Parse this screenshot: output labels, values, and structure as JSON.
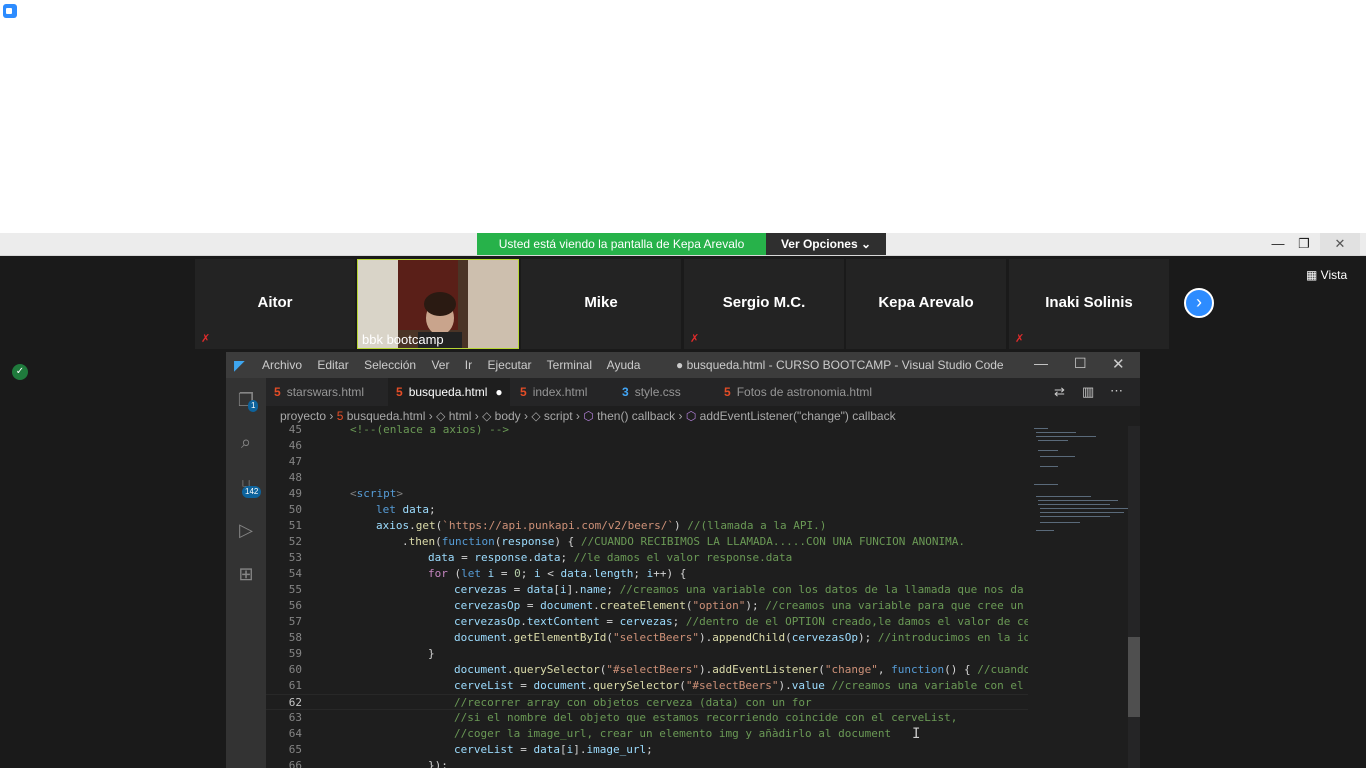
{
  "zoom": {
    "banner_text": "Usted está viendo la pantalla de Kepa Arevalo",
    "view_options": "Ver Opciones",
    "view_label": "Vista",
    "participants": [
      {
        "name": "Aitor",
        "muted": true
      },
      {
        "name": "bbk bootcamp",
        "muted": false,
        "video": true
      },
      {
        "name": "Mike",
        "muted": false
      },
      {
        "name": "Sergio M.C.",
        "muted": true
      },
      {
        "name": "Kepa Arevalo",
        "muted": false
      },
      {
        "name": "Inaki Solinis",
        "muted": true
      }
    ]
  },
  "vscode": {
    "title": "● busqueda.html - CURSO BOOTCAMP - Visual Studio Code",
    "menu": [
      "Archivo",
      "Editar",
      "Selección",
      "Ver",
      "Ir",
      "Ejecutar",
      "Terminal",
      "Ayuda"
    ],
    "tabs": [
      {
        "label": "starswars.html",
        "icon": "html-icon",
        "active": false
      },
      {
        "label": "busqueda.html",
        "icon": "html-icon",
        "active": true,
        "modified": true
      },
      {
        "label": "index.html",
        "icon": "html-icon",
        "active": false
      },
      {
        "label": "style.css",
        "icon": "css-icon",
        "active": false
      },
      {
        "label": "Fotos de astronomia.html",
        "icon": "html-icon",
        "active": false
      }
    ],
    "breadcrumb": [
      "proyecto",
      "busqueda.html",
      "html",
      "body",
      "script",
      "then() callback",
      "addEventListener(\"change\") callback"
    ],
    "explorer_badge": "1",
    "scm_badge": "142",
    "current_line": 62
  },
  "colors": {
    "banner_green": "#27b24a",
    "zoom_blue": "#2d8cff",
    "vscode_bg": "#1e1e1e",
    "keyword": "#569cd6",
    "string": "#ce9178",
    "comment": "#6a9955",
    "function": "#dcdcaa",
    "variable": "#9cdcfe"
  }
}
